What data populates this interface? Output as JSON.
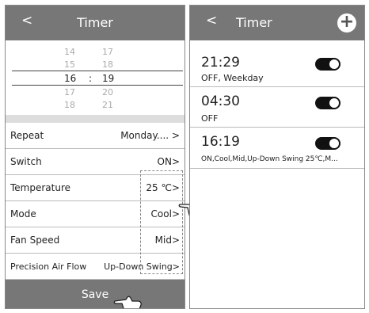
{
  "left": {
    "header": {
      "back": "<",
      "title": "Timer"
    },
    "picker": {
      "rows": [
        {
          "hour": "14",
          "minute": "17"
        },
        {
          "hour": "15",
          "minute": "18"
        },
        {
          "hour": "16",
          "minute": "19"
        },
        {
          "hour": "17",
          "minute": "20"
        },
        {
          "hour": "18",
          "minute": "21"
        }
      ],
      "separator": ":"
    },
    "settings": [
      {
        "label": "Repeat",
        "value": "Monday....  >"
      },
      {
        "label": "Switch",
        "value": "ON>"
      },
      {
        "label": "Temperature",
        "value": "25 ℃>"
      },
      {
        "label": "Mode",
        "value": "Cool>"
      },
      {
        "label": "Fan Speed",
        "value": "Mid>"
      },
      {
        "label": "Precision Air Flow",
        "value": "Up-Down Swing>"
      }
    ],
    "save_label": "Save"
  },
  "right": {
    "header": {
      "back": "<",
      "title": "Timer",
      "add": "+"
    },
    "timers": [
      {
        "time": "21:29",
        "info": "OFF, Weekday",
        "enabled": true
      },
      {
        "time": "04:30",
        "info": "OFF",
        "enabled": true
      },
      {
        "time": "16:19",
        "info": "ON,Cool,Mid,Up-Down Swing 25℃,M...",
        "enabled": true
      }
    ]
  },
  "icons": {
    "pointer": "hand-pointer-icon"
  }
}
